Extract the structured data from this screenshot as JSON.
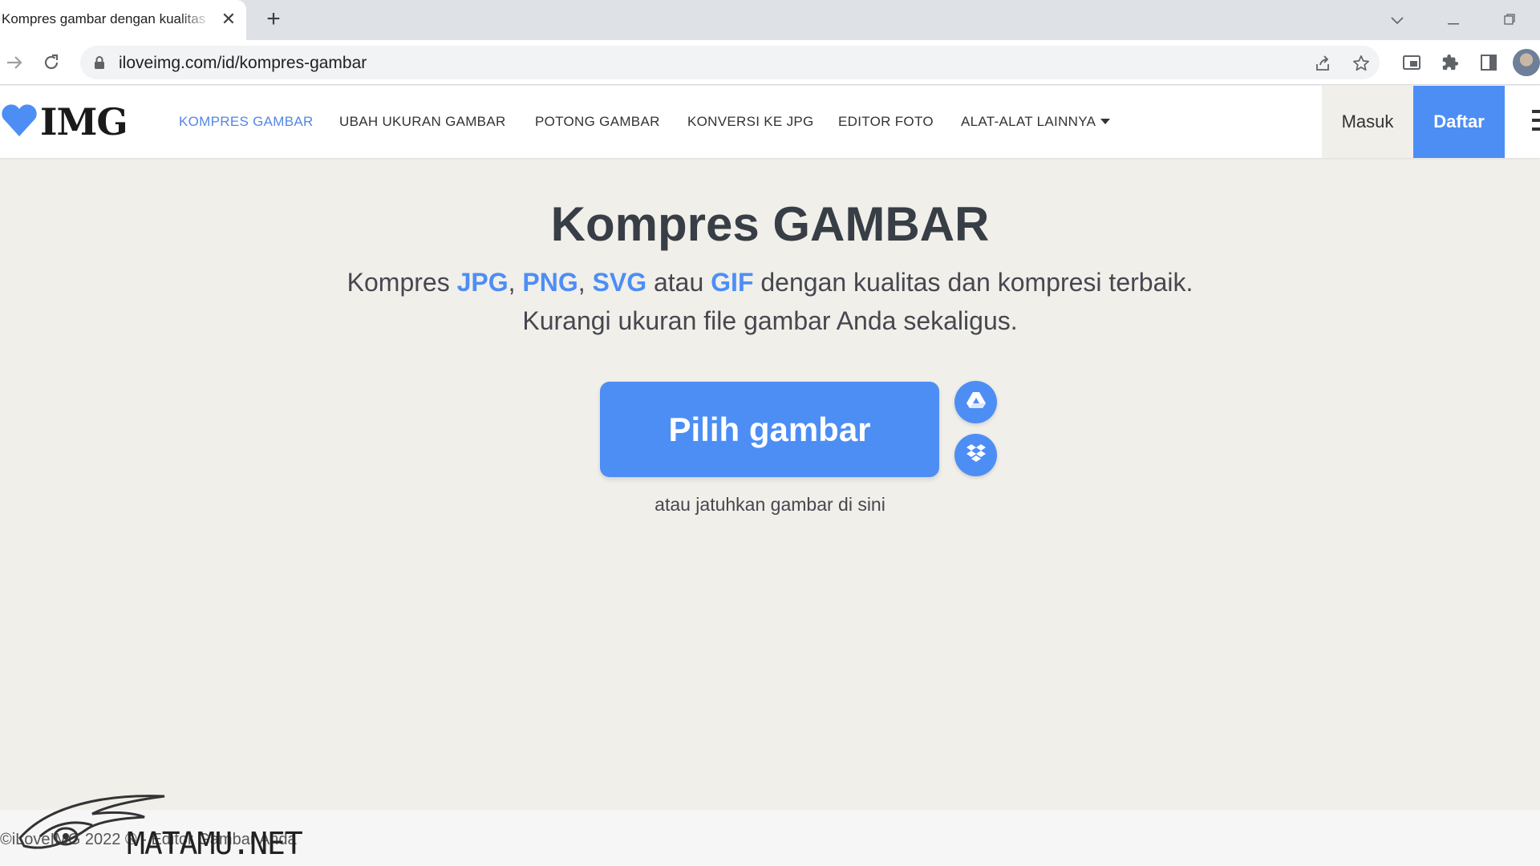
{
  "browser": {
    "tab_title": "Kompres gambar dengan kualitas",
    "tab_close": "✕",
    "new_tab": "+",
    "url": "iloveimg.com/id/kompres-gambar"
  },
  "site": {
    "logo_text": "IMG",
    "nav": [
      {
        "label": "KOMPRES GAMBAR",
        "active": true
      },
      {
        "label": "UBAH UKURAN GAMBAR"
      },
      {
        "label": "POTONG GAMBAR"
      },
      {
        "label": "KONVERSI KE JPG"
      },
      {
        "label": "EDITOR FOTO"
      },
      {
        "label": "ALAT-ALAT LAINNYA"
      }
    ],
    "login_label": "Masuk",
    "signup_label": "Daftar"
  },
  "main": {
    "title": "Kompres GAMBAR",
    "sub_prefix": "Kompres ",
    "formats": [
      "JPG",
      "PNG",
      "SVG",
      "GIF"
    ],
    "sep_comma": ", ",
    "sep_atau": " atau ",
    "sub_suffix": " dengan kualitas dan kompresi terbaik.",
    "sub_line2": "Kurangi ukuran file gambar Anda sekaligus.",
    "pick_button": "Pilih gambar",
    "drop_hint": "atau jatuhkan gambar di sini"
  },
  "footer": {
    "text": "©iLoveIMG 2022 ® - Editor Gambar Anda"
  },
  "watermark": {
    "text": "MATAMU.NET"
  },
  "colors": {
    "accent": "#4d8ef5",
    "nav_active": "#5386e4",
    "page_bg": "#f1efea"
  },
  "icons": [
    "lock-icon",
    "back-icon",
    "reload-icon",
    "share-icon",
    "star-icon",
    "google-drive-icon",
    "dropbox-icon",
    "heart-icon"
  ]
}
